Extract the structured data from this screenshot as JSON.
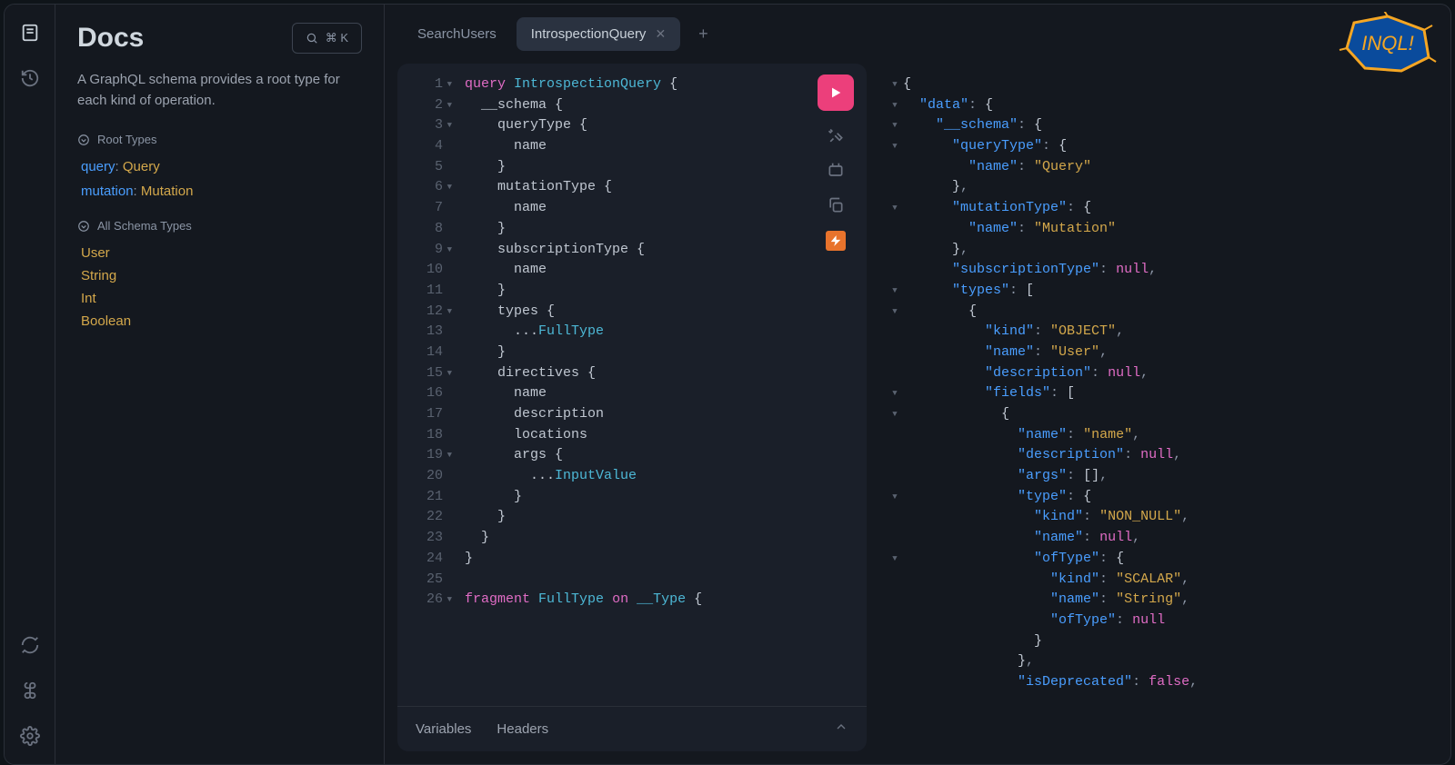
{
  "docs": {
    "title": "Docs",
    "search_shortcut": "⌘ K",
    "description": "A GraphQL schema provides a root type for each kind of operation.",
    "root_types_label": "Root Types",
    "all_schema_label": "All Schema Types",
    "root_types": [
      {
        "key": "query",
        "type": "Query"
      },
      {
        "key": "mutation",
        "type": "Mutation"
      }
    ],
    "schema_types": [
      "User",
      "String",
      "Int",
      "Boolean"
    ]
  },
  "tabs": {
    "items": [
      {
        "label": "SearchUsers",
        "active": false,
        "closable": false
      },
      {
        "label": "IntrospectionQuery",
        "active": true,
        "closable": true
      }
    ]
  },
  "editor": {
    "lines": [
      {
        "n": 1,
        "fold": true,
        "html": "<span class='kw'>query</span> <span class='name'>IntrospectionQuery</span> {"
      },
      {
        "n": 2,
        "fold": true,
        "html": "  __schema {"
      },
      {
        "n": 3,
        "fold": true,
        "html": "    queryType {"
      },
      {
        "n": 4,
        "fold": false,
        "html": "      name"
      },
      {
        "n": 5,
        "fold": false,
        "html": "    }"
      },
      {
        "n": 6,
        "fold": true,
        "html": "    mutationType {"
      },
      {
        "n": 7,
        "fold": false,
        "html": "      name"
      },
      {
        "n": 8,
        "fold": false,
        "html": "    }"
      },
      {
        "n": 9,
        "fold": true,
        "html": "    subscriptionType {"
      },
      {
        "n": 10,
        "fold": false,
        "html": "      name"
      },
      {
        "n": 11,
        "fold": false,
        "html": "    }"
      },
      {
        "n": 12,
        "fold": true,
        "html": "    types {"
      },
      {
        "n": 13,
        "fold": false,
        "html": "      ...<span class='frag'>FullType</span>"
      },
      {
        "n": 14,
        "fold": false,
        "html": "    }"
      },
      {
        "n": 15,
        "fold": true,
        "html": "    directives {"
      },
      {
        "n": 16,
        "fold": false,
        "html": "      name"
      },
      {
        "n": 17,
        "fold": false,
        "html": "      description"
      },
      {
        "n": 18,
        "fold": false,
        "html": "      locations"
      },
      {
        "n": 19,
        "fold": true,
        "html": "      args {"
      },
      {
        "n": 20,
        "fold": false,
        "html": "        ...<span class='frag'>InputValue</span>"
      },
      {
        "n": 21,
        "fold": false,
        "html": "      }"
      },
      {
        "n": 22,
        "fold": false,
        "html": "    }"
      },
      {
        "n": 23,
        "fold": false,
        "html": "  }"
      },
      {
        "n": 24,
        "fold": false,
        "html": "}"
      },
      {
        "n": 25,
        "fold": false,
        "html": ""
      },
      {
        "n": 26,
        "fold": true,
        "html": "<span class='kw'>fragment</span> <span class='name'>FullType</span> <span class='on'>on</span> <span class='name'>__Type</span> {"
      }
    ],
    "footer": {
      "variables": "Variables",
      "headers": "Headers"
    }
  },
  "response": {
    "lines": [
      {
        "fold": true,
        "indent": 0,
        "html": "{"
      },
      {
        "fold": true,
        "indent": 1,
        "html": "<span class='jkey'>\"data\"</span><span class='jpunc'>: </span>{"
      },
      {
        "fold": true,
        "indent": 2,
        "html": "<span class='jkey'>\"__schema\"</span><span class='jpunc'>: </span>{"
      },
      {
        "fold": true,
        "indent": 3,
        "html": "<span class='jkey'>\"queryType\"</span><span class='jpunc'>: </span>{"
      },
      {
        "fold": false,
        "indent": 4,
        "html": "<span class='jkey'>\"name\"</span><span class='jpunc'>: </span><span class='jstr'>\"Query\"</span>"
      },
      {
        "fold": false,
        "indent": 3,
        "html": "}<span class='jpunc'>,</span>"
      },
      {
        "fold": true,
        "indent": 3,
        "html": "<span class='jkey'>\"mutationType\"</span><span class='jpunc'>: </span>{"
      },
      {
        "fold": false,
        "indent": 4,
        "html": "<span class='jkey'>\"name\"</span><span class='jpunc'>: </span><span class='jstr'>\"Mutation\"</span>"
      },
      {
        "fold": false,
        "indent": 3,
        "html": "}<span class='jpunc'>,</span>"
      },
      {
        "fold": false,
        "indent": 3,
        "html": "<span class='jkey'>\"subscriptionType\"</span><span class='jpunc'>: </span><span class='jnull'>null</span><span class='jpunc'>,</span>"
      },
      {
        "fold": true,
        "indent": 3,
        "html": "<span class='jkey'>\"types\"</span><span class='jpunc'>: </span>["
      },
      {
        "fold": true,
        "indent": 4,
        "html": "{"
      },
      {
        "fold": false,
        "indent": 5,
        "html": "<span class='jkey'>\"kind\"</span><span class='jpunc'>: </span><span class='jstr'>\"OBJECT\"</span><span class='jpunc'>,</span>"
      },
      {
        "fold": false,
        "indent": 5,
        "html": "<span class='jkey'>\"name\"</span><span class='jpunc'>: </span><span class='jstr'>\"User\"</span><span class='jpunc'>,</span>"
      },
      {
        "fold": false,
        "indent": 5,
        "html": "<span class='jkey'>\"description\"</span><span class='jpunc'>: </span><span class='jnull'>null</span><span class='jpunc'>,</span>"
      },
      {
        "fold": true,
        "indent": 5,
        "html": "<span class='jkey'>\"fields\"</span><span class='jpunc'>: </span>["
      },
      {
        "fold": true,
        "indent": 6,
        "html": "{"
      },
      {
        "fold": false,
        "indent": 7,
        "html": "<span class='jkey'>\"name\"</span><span class='jpunc'>: </span><span class='jstr'>\"name\"</span><span class='jpunc'>,</span>"
      },
      {
        "fold": false,
        "indent": 7,
        "html": "<span class='jkey'>\"description\"</span><span class='jpunc'>: </span><span class='jnull'>null</span><span class='jpunc'>,</span>"
      },
      {
        "fold": false,
        "indent": 7,
        "html": "<span class='jkey'>\"args\"</span><span class='jpunc'>: </span>[]<span class='jpunc'>,</span>"
      },
      {
        "fold": true,
        "indent": 7,
        "html": "<span class='jkey'>\"type\"</span><span class='jpunc'>: </span>{"
      },
      {
        "fold": false,
        "indent": 8,
        "html": "<span class='jkey'>\"kind\"</span><span class='jpunc'>: </span><span class='jstr'>\"NON_NULL\"</span><span class='jpunc'>,</span>"
      },
      {
        "fold": false,
        "indent": 8,
        "html": "<span class='jkey'>\"name\"</span><span class='jpunc'>: </span><span class='jnull'>null</span><span class='jpunc'>,</span>"
      },
      {
        "fold": true,
        "indent": 8,
        "html": "<span class='jkey'>\"ofType\"</span><span class='jpunc'>: </span>{"
      },
      {
        "fold": false,
        "indent": 9,
        "html": "<span class='jkey'>\"kind\"</span><span class='jpunc'>: </span><span class='jstr'>\"SCALAR\"</span><span class='jpunc'>,</span>"
      },
      {
        "fold": false,
        "indent": 9,
        "html": "<span class='jkey'>\"name\"</span><span class='jpunc'>: </span><span class='jstr'>\"String\"</span><span class='jpunc'>,</span>"
      },
      {
        "fold": false,
        "indent": 9,
        "html": "<span class='jkey'>\"ofType\"</span><span class='jpunc'>: </span><span class='jnull'>null</span>"
      },
      {
        "fold": false,
        "indent": 8,
        "html": "}"
      },
      {
        "fold": false,
        "indent": 7,
        "html": "}<span class='jpunc'>,</span>"
      },
      {
        "fold": false,
        "indent": 7,
        "html": "<span class='jkey'>\"isDeprecated\"</span><span class='jpunc'>: </span><span class='jbool'>false</span><span class='jpunc'>,</span>"
      }
    ]
  },
  "logo_text": "INQL!"
}
